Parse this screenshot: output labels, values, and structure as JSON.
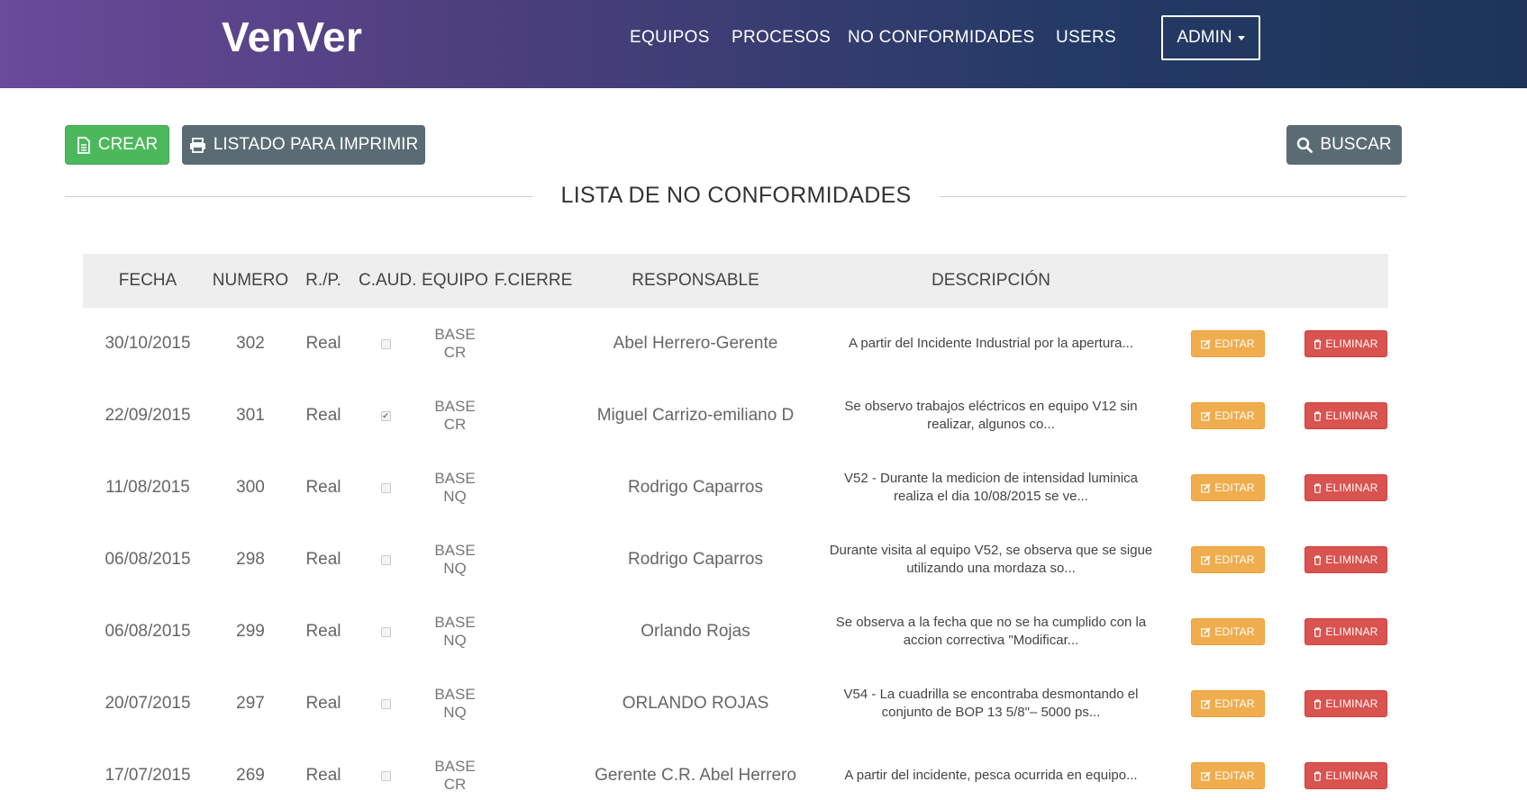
{
  "navbar": {
    "brand": "VenVer",
    "links": [
      "EQUIPOS",
      "PROCESOS",
      "NO CONFORMIDADES",
      "USERS"
    ],
    "admin_label": "ADMIN",
    "colors": {
      "gradient_start": "#6a4a9a",
      "gradient_end": "#1e3559"
    }
  },
  "toolbar": {
    "create_label": "CREAR",
    "print_label": "LISTADO PARA IMPRIMIR",
    "search_label": "BUSCAR",
    "icons": {
      "create": "file-icon",
      "print": "print-icon",
      "search": "search-icon"
    },
    "colors": {
      "create": "#4cb85c",
      "secondary": "#5a6b73"
    }
  },
  "page": {
    "title": "LISTA DE NO CONFORMIDADES"
  },
  "table": {
    "headers": {
      "fecha": "FECHA",
      "numero": "NUMERO",
      "rp": "R./P.",
      "caud": "C.AUD.",
      "equipo": "EQUIPO",
      "fcierre": "F.CIERRE",
      "responsable": "RESPONSABLE",
      "descripcion": "DESCRIPCIÓN"
    },
    "edit_label": "EDITAR",
    "delete_label": "ELIMINAR",
    "colors": {
      "edit": "#f0ad4e",
      "delete": "#d9534f"
    },
    "rows": [
      {
        "fecha": "30/10/2015",
        "numero": "302",
        "rp": "Real",
        "caud": false,
        "equipo_line1": "BASE",
        "equipo_line2": "CR",
        "fcierre": "",
        "responsable": "Abel Herrero-Gerente",
        "descripcion": "A partir del Incidente Industrial por la apertura..."
      },
      {
        "fecha": "22/09/2015",
        "numero": "301",
        "rp": "Real",
        "caud": true,
        "equipo_line1": "BASE",
        "equipo_line2": "CR",
        "fcierre": "",
        "responsable": "Miguel Carrizo-emiliano D",
        "descripcion": "Se observo trabajos eléctricos en equipo V12 sin realizar, algunos co..."
      },
      {
        "fecha": "11/08/2015",
        "numero": "300",
        "rp": "Real",
        "caud": false,
        "equipo_line1": "BASE",
        "equipo_line2": "NQ",
        "fcierre": "",
        "responsable": "Rodrigo Caparros",
        "descripcion": "V52 - Durante la medicion de intensidad luminica realiza el dia 10/08/2015 se ve..."
      },
      {
        "fecha": "06/08/2015",
        "numero": "298",
        "rp": "Real",
        "caud": false,
        "equipo_line1": "BASE",
        "equipo_line2": "NQ",
        "fcierre": "",
        "responsable": "Rodrigo Caparros",
        "descripcion": "Durante visita al equipo V52, se observa que se sigue utilizando una mordaza so..."
      },
      {
        "fecha": "06/08/2015",
        "numero": "299",
        "rp": "Real",
        "caud": false,
        "equipo_line1": "BASE",
        "equipo_line2": "NQ",
        "fcierre": "",
        "responsable": "Orlando Rojas",
        "descripcion": "Se observa a la fecha que no se ha cumplido con la accion correctiva \"Modificar..."
      },
      {
        "fecha": "20/07/2015",
        "numero": "297",
        "rp": "Real",
        "caud": false,
        "equipo_line1": "BASE",
        "equipo_line2": "NQ",
        "fcierre": "",
        "responsable": "ORLANDO ROJAS",
        "descripcion": "V54 - La cuadrilla se encontraba desmontando el conjunto de BOP 13 5/8\"– 5000 ps..."
      },
      {
        "fecha": "17/07/2015",
        "numero": "269",
        "rp": "Real",
        "caud": false,
        "equipo_line1": "BASE",
        "equipo_line2": "CR",
        "fcierre": "",
        "responsable": "Gerente C.R. Abel Herrero",
        "descripcion": "A partir del incidente, pesca ocurrida en equipo..."
      }
    ]
  }
}
